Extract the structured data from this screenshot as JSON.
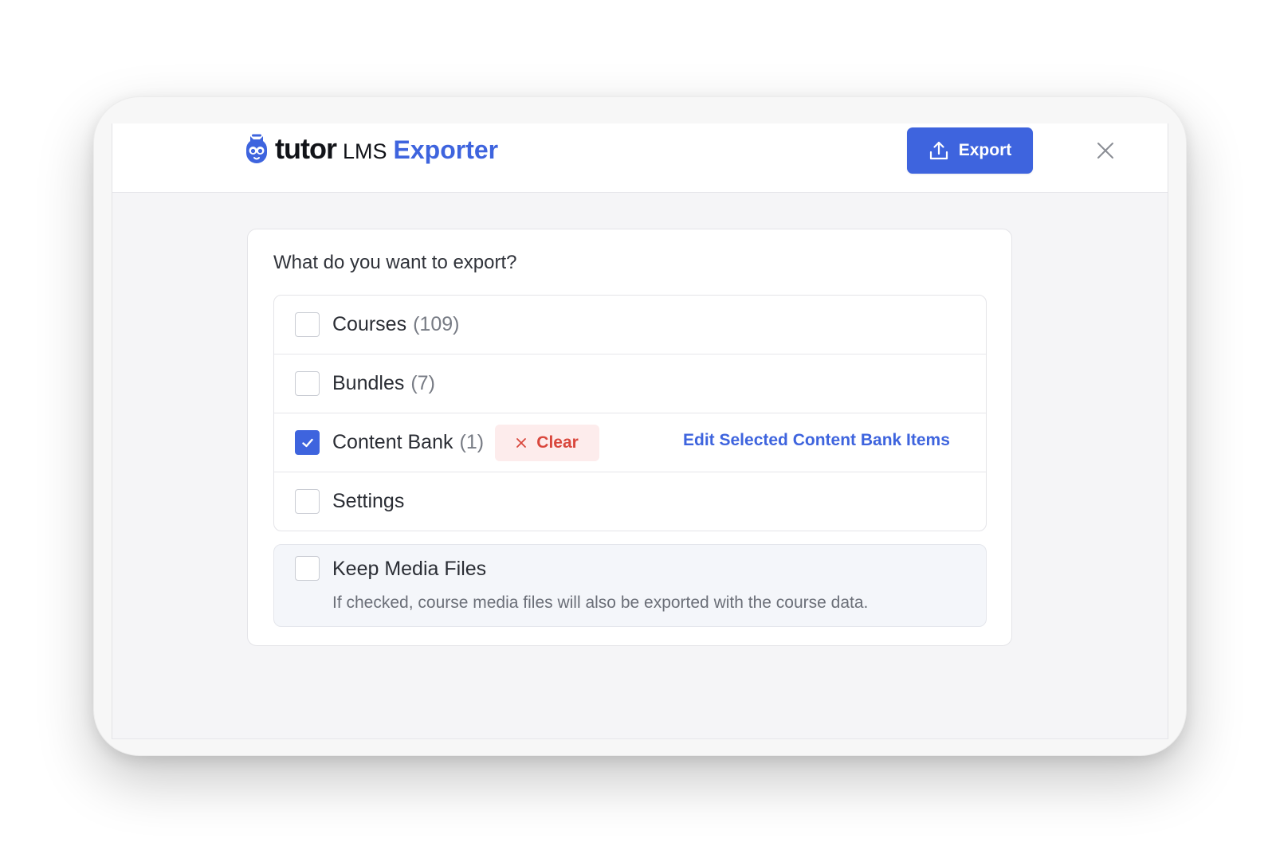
{
  "brand": {
    "name": "tutor",
    "suffix": "LMS",
    "product": "Exporter",
    "accent": "#3e64de"
  },
  "header": {
    "export_label": "Export",
    "export_icon": "upload-icon",
    "close_icon": "close-icon"
  },
  "main": {
    "question": "What do you want to export?",
    "options": [
      {
        "label": "Courses",
        "count": "(109)",
        "checked": false
      },
      {
        "label": "Bundles",
        "count": "(7)",
        "checked": false
      },
      {
        "label": "Content Bank",
        "count": "(1)",
        "checked": true,
        "clear_label": "Clear",
        "edit_link": "Edit Selected Content Bank Items"
      },
      {
        "label": "Settings",
        "count": "",
        "checked": false
      }
    ],
    "media": {
      "label": "Keep Media Files",
      "description": "If checked, course media files will also be exported with the course data.",
      "checked": false
    }
  },
  "colors": {
    "clear_text": "#d9473d",
    "clear_bg": "#fdecec"
  }
}
